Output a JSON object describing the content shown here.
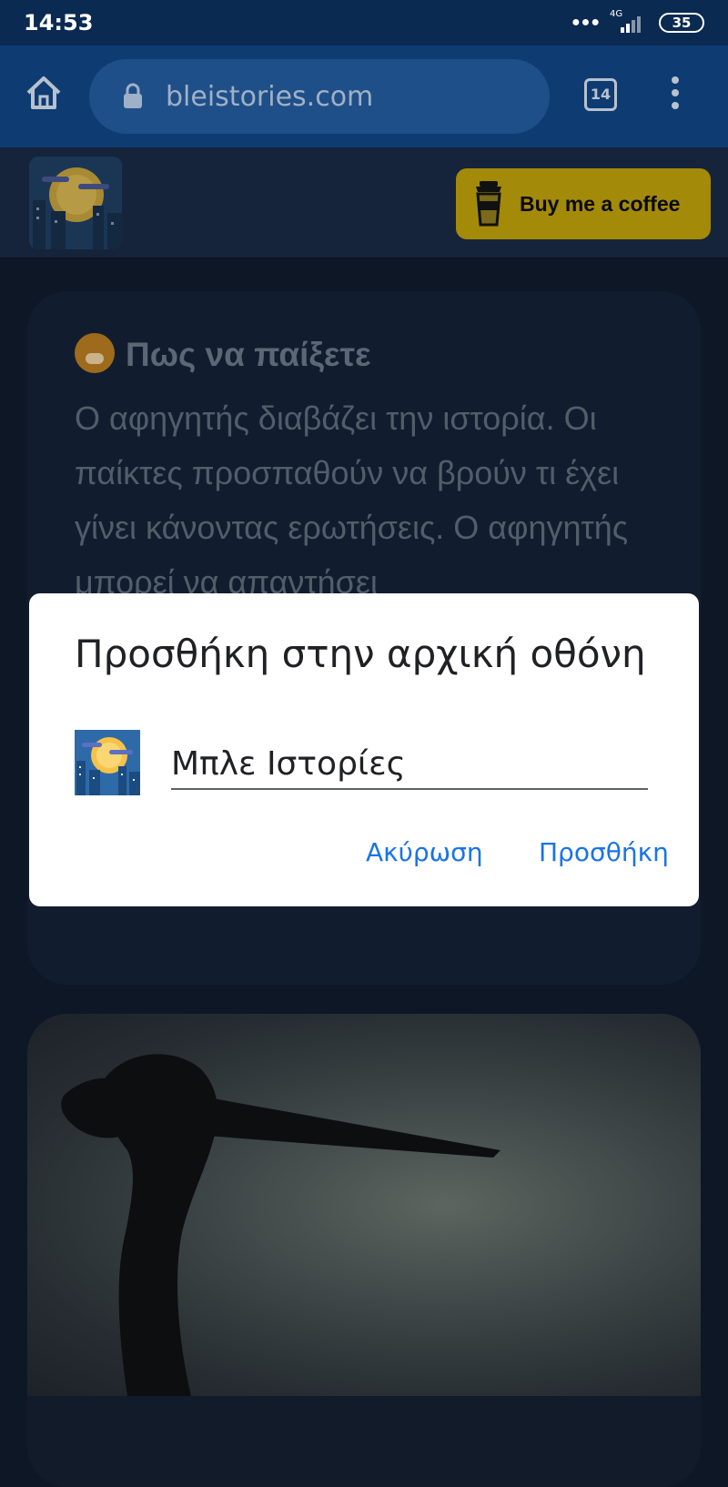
{
  "status_bar": {
    "time": "14:53",
    "network_label": "4G",
    "battery": "35"
  },
  "browser": {
    "url": "bleistories.com",
    "tab_count": "14",
    "icons": [
      "home-icon",
      "lock-icon",
      "tabs-icon",
      "more-vert-icon"
    ]
  },
  "site_header": {
    "coffee_label": "Buy me a coffee",
    "coffee_color": "#a38a09"
  },
  "card": {
    "title": "Πως να παίξετε",
    "body": "Ο αφηγητής διαβάζει την ιστορία. Οι παίκτες προσπαθούν να βρούν τι έχει γίνει κάνοντας ερωτήσεις. Ο αφηγητής μπορεί να απαντήσει"
  },
  "dialog": {
    "title": "Προσθήκη στην αρχική οθόνη",
    "input_value": "Μπλε Ιστορίες",
    "cancel_label": "Ακύρωση",
    "add_label": "Προσθήκη",
    "accent_color": "#1a73e8"
  }
}
